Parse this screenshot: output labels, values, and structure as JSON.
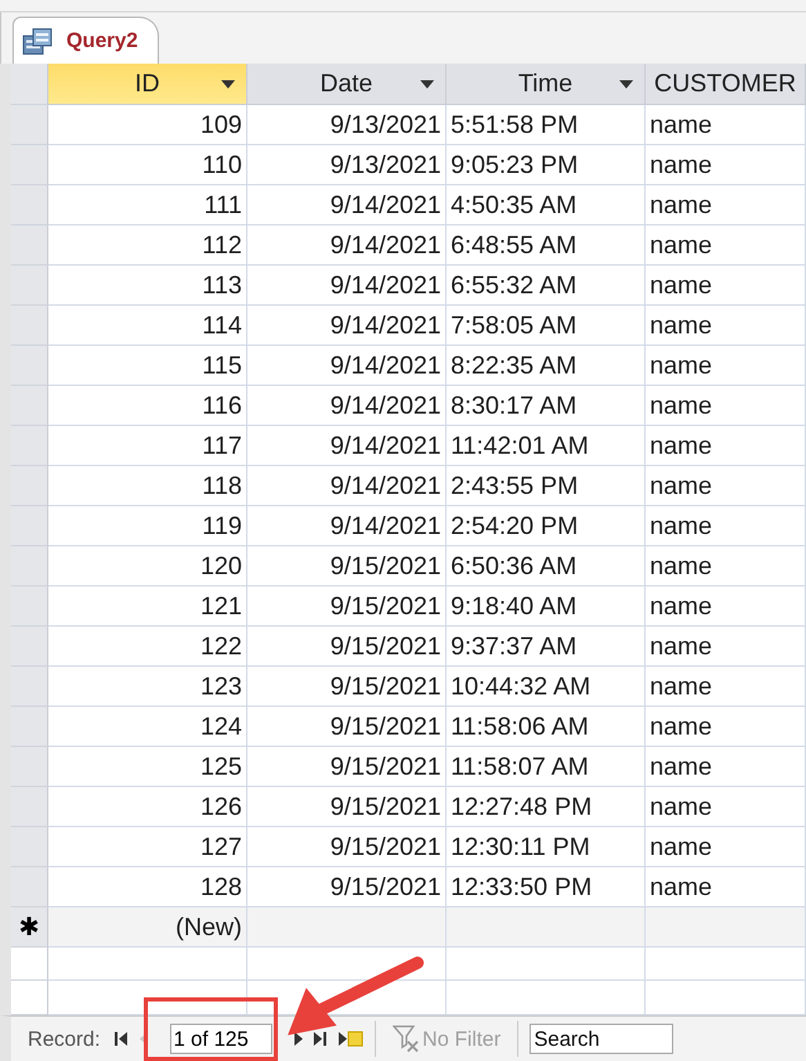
{
  "tab": {
    "title": "Query2",
    "selected": true
  },
  "columns": [
    {
      "label": "ID",
      "selected": true,
      "dropdown": true,
      "kind": "number"
    },
    {
      "label": "Date",
      "selected": false,
      "dropdown": true,
      "kind": "date"
    },
    {
      "label": "Time",
      "selected": false,
      "dropdown": true,
      "kind": "time"
    },
    {
      "label": "CUSTOMER",
      "selected": false,
      "dropdown": false,
      "kind": "text"
    }
  ],
  "rows": [
    [
      "109",
      "9/13/2021",
      "5:51:58 PM",
      "name"
    ],
    [
      "110",
      "9/13/2021",
      "9:05:23 PM",
      "name"
    ],
    [
      "111",
      "9/14/2021",
      "4:50:35 AM",
      "name"
    ],
    [
      "112",
      "9/14/2021",
      "6:48:55 AM",
      "name"
    ],
    [
      "113",
      "9/14/2021",
      "6:55:32 AM",
      "name"
    ],
    [
      "114",
      "9/14/2021",
      "7:58:05 AM",
      "name"
    ],
    [
      "115",
      "9/14/2021",
      "8:22:35 AM",
      "name"
    ],
    [
      "116",
      "9/14/2021",
      "8:30:17 AM",
      "name"
    ],
    [
      "117",
      "9/14/2021",
      "11:42:01 AM",
      "name"
    ],
    [
      "118",
      "9/14/2021",
      "2:43:55 PM",
      "name"
    ],
    [
      "119",
      "9/14/2021",
      "2:54:20 PM",
      "name"
    ],
    [
      "120",
      "9/15/2021",
      "6:50:36 AM",
      "name"
    ],
    [
      "121",
      "9/15/2021",
      "9:18:40 AM",
      "name"
    ],
    [
      "122",
      "9/15/2021",
      "9:37:37 AM",
      "name"
    ],
    [
      "123",
      "9/15/2021",
      "10:44:32 AM",
      "name"
    ],
    [
      "124",
      "9/15/2021",
      "11:58:06 AM",
      "name"
    ],
    [
      "125",
      "9/15/2021",
      "11:58:07 AM",
      "name"
    ],
    [
      "126",
      "9/15/2021",
      "12:27:48 PM",
      "name"
    ],
    [
      "127",
      "9/15/2021",
      "12:30:11 PM",
      "name"
    ],
    [
      "128",
      "9/15/2021",
      "12:33:50 PM",
      "name"
    ]
  ],
  "new_row": {
    "marker": "✱",
    "label": "(New)"
  },
  "navigation": {
    "label": "Record:",
    "position": "1 of 125",
    "previous_disabled": true,
    "filter": {
      "label": "No Filter",
      "disabled": true
    },
    "search": {
      "placeholder": "Search"
    }
  },
  "annotation": {
    "kind": "box-and-arrow",
    "color": "#e8413c"
  }
}
